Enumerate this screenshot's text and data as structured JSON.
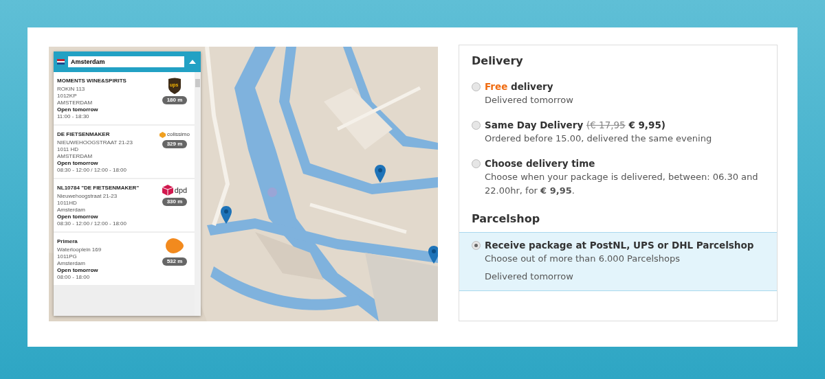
{
  "map": {
    "kind": "picture",
    "search": {
      "value": "Amsterdam"
    },
    "shops": [
      {
        "name": "MOMENTS WINE&SPIRITS",
        "address": [
          "ROKIN 113",
          "1012KP",
          "AMSTERDAM"
        ],
        "status": "Open tomorrow",
        "hours": "11:00 - 18:30",
        "distance": "180 m",
        "logo": {
          "kind": "ups",
          "text": "ups"
        }
      },
      {
        "name": "DE FIETSENMAKER",
        "address": [
          "NIEUWEHOOGSTRAAT 21-23",
          "1011 HD",
          "AMSTERDAM"
        ],
        "status": "Open tomorrow",
        "hours": "08:30 - 12:00 / 12:00 - 18:00",
        "distance": "329 m",
        "logo": {
          "kind": "colissimo",
          "text": "colissimo"
        }
      },
      {
        "name": "NL10784 \"DE FIETSENMAKER\"",
        "address": [
          "Nieuwehoogstraat 21-23",
          "1011HD",
          "Amsterdam"
        ],
        "status": "Open tomorrow",
        "hours": "08:30 - 12:00 / 12:00 - 18:00",
        "distance": "330 m",
        "logo": {
          "kind": "dpd",
          "text": "dpd"
        }
      },
      {
        "name": "Primera",
        "address": [
          "Waterlooplein 169",
          "1011PG",
          "Amsterdam"
        ],
        "status": "Open tomorrow",
        "hours": "08:00 - 18:00",
        "distance": "532 m",
        "logo": {
          "kind": "postnl"
        }
      }
    ]
  },
  "options": {
    "sections": [
      {
        "heading": "Delivery",
        "items": [
          {
            "selected": false,
            "title": [
              {
                "kind": "accent",
                "text": "Free"
              },
              {
                "kind": "text",
                "text": " delivery"
              }
            ],
            "lines": [
              "Delivered tomorrow"
            ]
          },
          {
            "selected": false,
            "title": [
              {
                "kind": "text",
                "text": "Same Day Delivery "
              },
              {
                "kind": "old-price",
                "text": "(€ 17,95"
              },
              {
                "kind": "text",
                "text": " € 9,95)"
              }
            ],
            "lines": [
              "Ordered before 15.00, delivered the same evening"
            ]
          },
          {
            "selected": false,
            "title": [
              {
                "kind": "text",
                "text": "Choose delivery time"
              }
            ],
            "lines": [
              "Choose when your package is delivered, between: 06.30 and 22.00hr, for **€ 9,95**."
            ]
          }
        ]
      },
      {
        "heading": "Parcelshop",
        "items": [
          {
            "selected": true,
            "title": [
              {
                "kind": "text",
                "text": "Receive package at PostNL, UPS or DHL Parcelshop"
              }
            ],
            "lines": [
              "Choose out of more than 6.000 Parcelshops",
              "Delivered tomorrow"
            ]
          }
        ]
      }
    ]
  }
}
